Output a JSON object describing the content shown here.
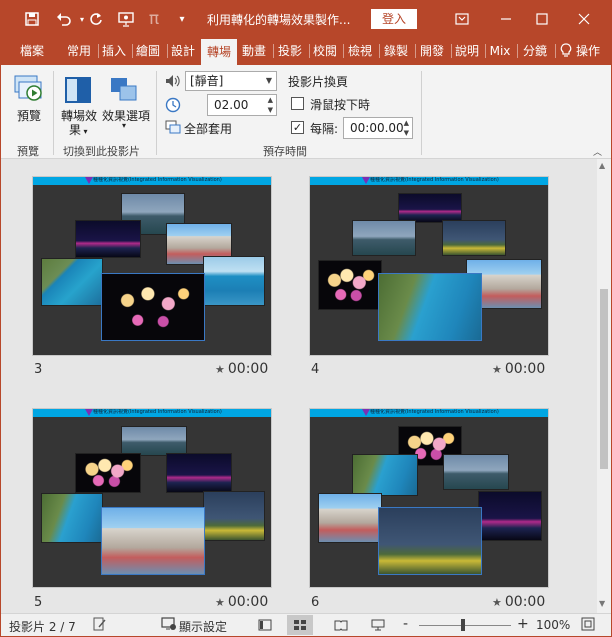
{
  "titlebar": {
    "title": "利用轉化的轉場效果製作...",
    "signin_label": "登入",
    "icons": [
      "save-icon",
      "undo-icon",
      "redo-icon",
      "present-icon",
      "pi-icon",
      "customize-qat-icon"
    ],
    "pi_glyph": "π",
    "brand_color": "#b7472a"
  },
  "tabs": [
    {
      "label": "檔案"
    },
    {
      "label": "常用"
    },
    {
      "label": "插入"
    },
    {
      "label": "繪圖"
    },
    {
      "label": "設計"
    },
    {
      "label": "轉場"
    },
    {
      "label": "動畫"
    },
    {
      "label": "投影"
    },
    {
      "label": "校閱"
    },
    {
      "label": "檢視"
    },
    {
      "label": "錄製"
    },
    {
      "label": "開發"
    },
    {
      "label": "說明"
    },
    {
      "label": "Mix"
    },
    {
      "label": "分鏡"
    },
    {
      "label": "操作"
    }
  ],
  "active_tab": "轉場",
  "ribbon": {
    "preview_label": "預覽",
    "preview_group": "預覽",
    "transition_effect_label": "轉場效",
    "transition_effect_label2": "果",
    "effect_options_label": "效果選項",
    "transition_group": "切換到此投影片",
    "sound_value": "[靜音]",
    "duration_value": "02.00",
    "apply_all_label": "全部套用",
    "advance_title": "投影片換頁",
    "on_click_label": "滑鼠按下時",
    "after_label": "每隔:",
    "after_value": "00:00.00",
    "timing_group": "預存時間",
    "on_click_checked": false,
    "after_checked": true
  },
  "slides": [
    {
      "number": "3",
      "time": "00:00",
      "header": "種種化資訊視覺(Integrated Information Visualization)"
    },
    {
      "number": "4",
      "time": "00:00",
      "header": "種種化資訊視覺(Integrated Information Visualization)"
    },
    {
      "number": "5",
      "time": "00:00",
      "header": "種種化資訊視覺(Integrated Information Visualization)"
    },
    {
      "number": "6",
      "time": "00:00",
      "header": "種種化資訊視覺(Integrated Information Visualization)"
    }
  ],
  "statusbar": {
    "slide_counter": "投影片 2 / 7",
    "display_settings": "顯示設定",
    "zoom_minus": "-",
    "zoom_plus": "+",
    "zoom_value": "100%",
    "zoom_level": 100
  }
}
